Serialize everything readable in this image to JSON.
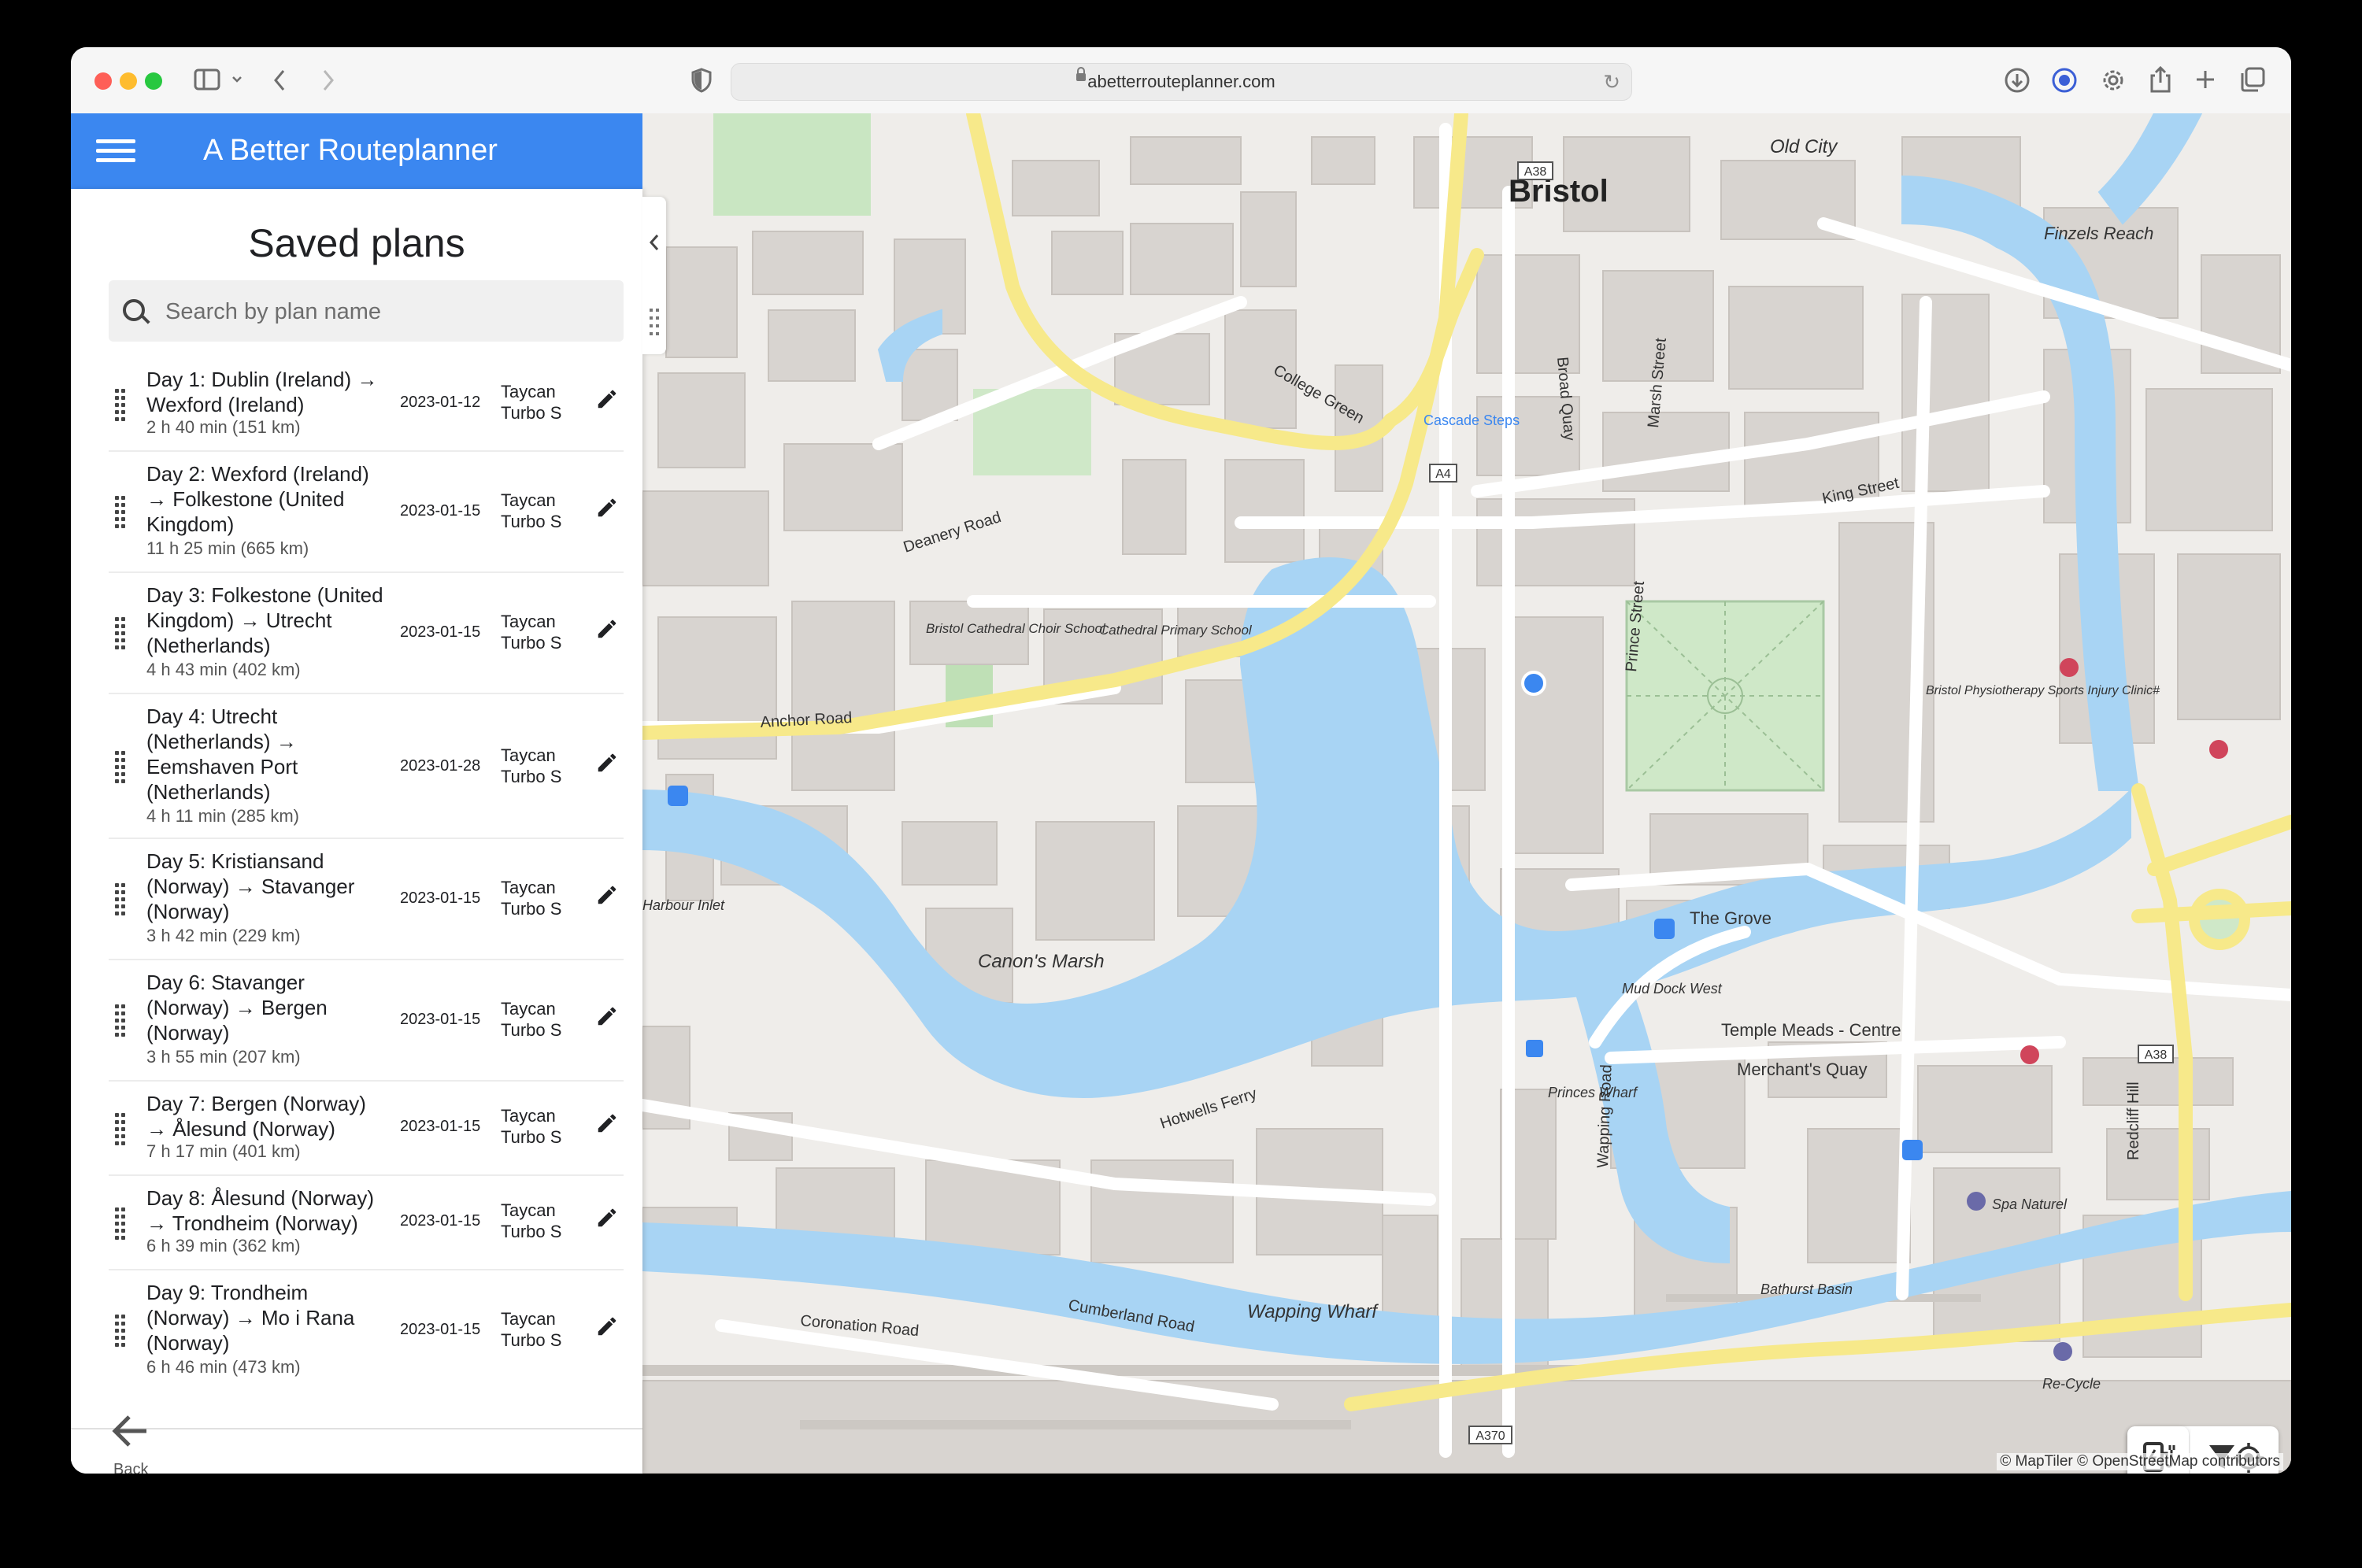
{
  "browser": {
    "url": "abetterrouteplanner.com"
  },
  "app": {
    "title": "A Better Routeplanner"
  },
  "panel": {
    "title": "Saved plans",
    "search_placeholder": "Search by plan name",
    "back_label": "Back"
  },
  "plans": [
    {
      "name": "Day 1: Dublin (Ireland) → Wexford (Ireland)",
      "meta": "2 h 40 min (151 km)",
      "date": "2023-01-12",
      "car": "Taycan Turbo S"
    },
    {
      "name": "Day 2: Wexford (Ireland) → Folkestone (United Kingdom)",
      "meta": "11 h 25 min (665 km)",
      "date": "2023-01-15",
      "car": "Taycan Turbo S"
    },
    {
      "name": "Day 3: Folkestone (United Kingdom) → Utrecht (Netherlands)",
      "meta": "4 h 43 min (402 km)",
      "date": "2023-01-15",
      "car": "Taycan Turbo S"
    },
    {
      "name": "Day 4: Utrecht (Netherlands) → Eemshaven Port (Netherlands)",
      "meta": "4 h 11 min (285 km)",
      "date": "2023-01-28",
      "car": "Taycan Turbo S"
    },
    {
      "name": "Day 5: Kristiansand (Norway) → Stavanger (Norway)",
      "meta": "3 h 42 min (229 km)",
      "date": "2023-01-15",
      "car": "Taycan Turbo S"
    },
    {
      "name": "Day 6: Stavanger (Norway) → Bergen (Norway)",
      "meta": "3 h 55 min (207 km)",
      "date": "2023-01-15",
      "car": "Taycan Turbo S"
    },
    {
      "name": "Day 7: Bergen (Norway) → Ålesund (Norway)",
      "meta": "7 h 17 min (401 km)",
      "date": "2023-01-15",
      "car": "Taycan Turbo S"
    },
    {
      "name": "Day 8: Ålesund (Norway) → Trondheim (Norway)",
      "meta": "6 h 39 min (362 km)",
      "date": "2023-01-15",
      "car": "Taycan Turbo S"
    },
    {
      "name": "Day 9: Trondheim (Norway) → Mo i Rana (Norway)",
      "meta": "6 h 46 min (473 km)",
      "date": "2023-01-15",
      "car": "Taycan Turbo S"
    }
  ],
  "map": {
    "labels": {
      "bristol": "Bristol",
      "old_city": "Old City",
      "finzels_reach": "Finzels Reach",
      "the_grove": "The Grove",
      "temple_meads": "Temple Meads - Centre",
      "merchants_quay": "Merchant's Quay",
      "canons_marsh": "Canon's Marsh",
      "wapping_wharf": "Wapping Wharf",
      "harbour_inlet": "Harbour Inlet",
      "mud_dock_west": "Mud Dock West",
      "princes_wharf": "Princes Wharf",
      "bathurst_basin": "Bathurst Basin",
      "cascade_steps": "Cascade Steps",
      "anchor_road": "Anchor Road",
      "coronation_road": "Coronation Road",
      "cumberland_road": "Cumberland Road",
      "hotwells_ferry": "Hotwells Ferry",
      "redcliff_hill": "Redcliff Hill",
      "king_street": "King Street",
      "marsh_street": "Marsh Street",
      "prince_street": "Prince Street",
      "broad_quay": "Broad Quay",
      "college_green": "College Green",
      "deanery_road": "Deanery Road",
      "wapping_road": "Wapping Road",
      "spa_naturel": "Spa Naturel",
      "re_cycle": "Re-Cycle",
      "bristol_cathedral_school": "Bristol Cathedral Choir School",
      "cathedral_primary": "Cathedral Primary School",
      "physio": "Bristol Physiotherapy Sports Injury Clinic#",
      "road_a38": "A38",
      "road_a4": "A4",
      "road_a370": "A370"
    },
    "attribution": "© MapTiler © OpenStreetMap contributors"
  },
  "icons": {
    "menu": "hamburger-menu-icon",
    "search": "search-icon",
    "drag": "drag-handle-icon",
    "edit": "pencil-edit-icon",
    "back": "arrow-left-icon",
    "charger": "charger-filter-icon",
    "filter": "funnel-filter-icon",
    "locate": "my-location-icon"
  },
  "colors": {
    "header": "#3b87f0",
    "water": "#a8d4f4",
    "road_major": "#f7e98a",
    "building": "#d8d4d0",
    "location_dot": "#3b87f0"
  }
}
